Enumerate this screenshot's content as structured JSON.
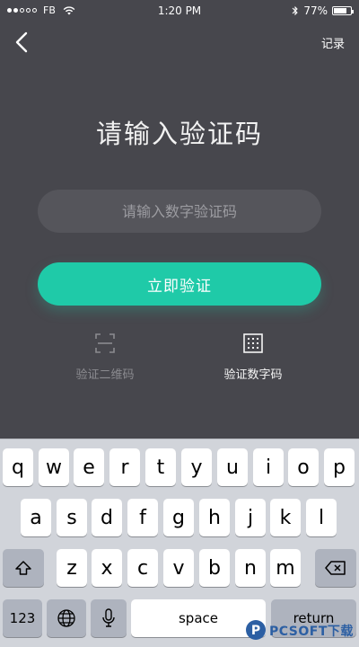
{
  "status_bar": {
    "carrier": "FB",
    "time": "1:20 PM",
    "battery": "77%",
    "battery_level": 0.77
  },
  "nav": {
    "back_icon": "chevron-left-icon",
    "record_label": "记录"
  },
  "main": {
    "title": "请输入验证码",
    "input": {
      "value": "",
      "placeholder": "请输入数字验证码"
    },
    "verify_button_label": "立即验证",
    "accent_color": "#1fcaa8",
    "options": [
      {
        "label": "验证二维码",
        "icon": "qr-scan-icon",
        "active": false
      },
      {
        "label": "验证数字码",
        "icon": "digit-code-icon",
        "active": true
      }
    ]
  },
  "keyboard": {
    "row1": [
      "q",
      "w",
      "e",
      "r",
      "t",
      "y",
      "u",
      "i",
      "o",
      "p"
    ],
    "row2": [
      "a",
      "s",
      "d",
      "f",
      "g",
      "h",
      "j",
      "k",
      "l"
    ],
    "row3": [
      "z",
      "x",
      "c",
      "v",
      "b",
      "n",
      "m"
    ],
    "shift_icon": "shift-icon",
    "delete_icon": "delete-icon",
    "numbers_label": "123",
    "globe_icon": "globe-icon",
    "mic_icon": "microphone-icon",
    "space_label": "space",
    "return_label": "return"
  },
  "watermark": {
    "text": "PCSOFT下载",
    "icon": "pcsoft-logo-icon"
  }
}
